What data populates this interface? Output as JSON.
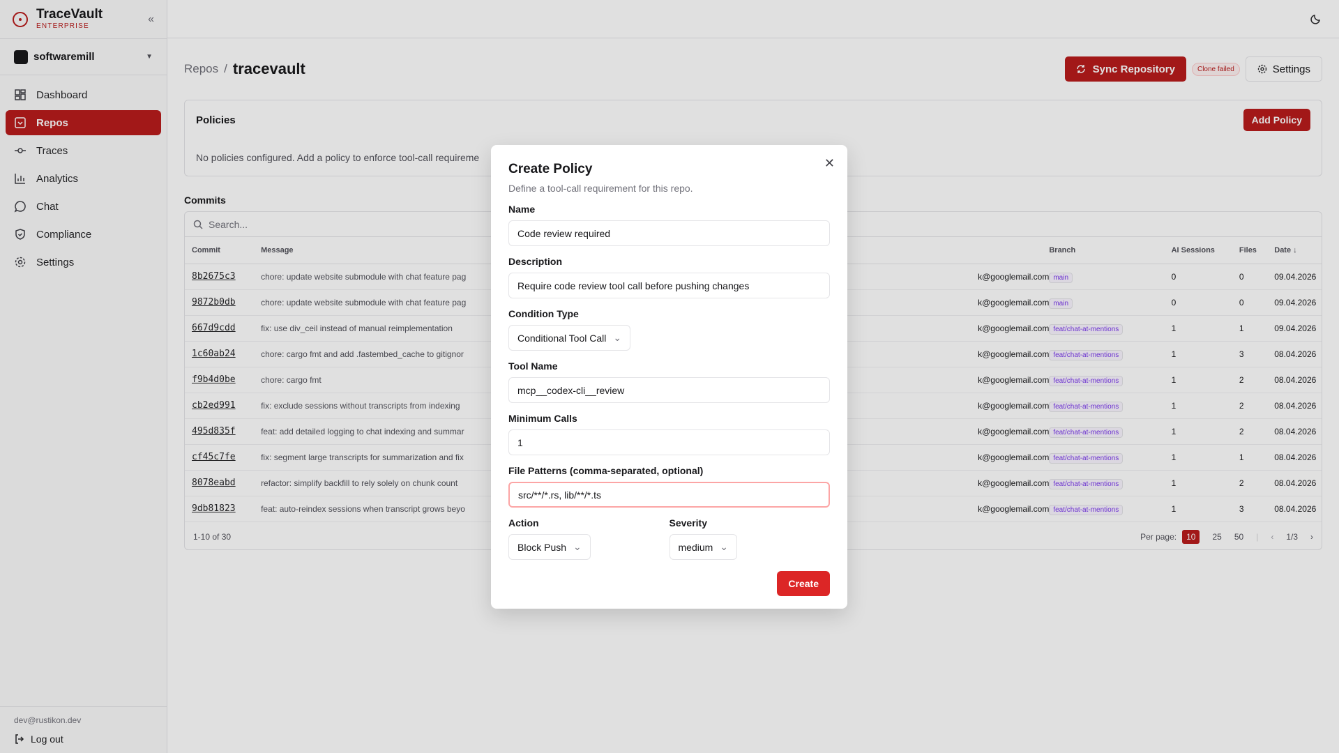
{
  "brand": {
    "name": "TraceVault",
    "tier": "ENTERPRISE"
  },
  "org": {
    "name": "softwaremill"
  },
  "nav": [
    {
      "label": "Dashboard",
      "icon": "dashboard-icon",
      "active": false
    },
    {
      "label": "Repos",
      "icon": "repo-icon",
      "active": true
    },
    {
      "label": "Traces",
      "icon": "traces-icon",
      "active": false
    },
    {
      "label": "Analytics",
      "icon": "analytics-icon",
      "active": false
    },
    {
      "label": "Chat",
      "icon": "chat-icon",
      "active": false
    },
    {
      "label": "Compliance",
      "icon": "shield-icon",
      "active": false
    },
    {
      "label": "Settings",
      "icon": "gear-icon",
      "active": false
    }
  ],
  "user": {
    "email": "dev@rustikon.dev",
    "logout_label": "Log out"
  },
  "breadcrumb": {
    "parent": "Repos",
    "separator": "/",
    "current": "tracevault"
  },
  "header": {
    "sync_label": "Sync Repository",
    "status_badge": "Clone failed",
    "settings_label": "Settings"
  },
  "policies": {
    "title": "Policies",
    "add_label": "Add Policy",
    "empty_text": "No policies configured. Add a policy to enforce tool-call requireme"
  },
  "commits": {
    "title": "Commits",
    "search_placeholder": "Search...",
    "columns": {
      "commit": "Commit",
      "message": "Message",
      "branch": "Branch",
      "sessions": "AI Sessions",
      "files": "Files",
      "date": "Date ↓"
    },
    "rows": [
      {
        "hash": "8b2675c3",
        "message": "chore: update website submodule with chat feature pag",
        "author": "k@googlemail.com",
        "branch": "main",
        "sessions": "0",
        "files": "0",
        "date": "09.04.2026"
      },
      {
        "hash": "9872b0db",
        "message": "chore: update website submodule with chat feature pag",
        "author": "k@googlemail.com",
        "branch": "main",
        "sessions": "0",
        "files": "0",
        "date": "09.04.2026"
      },
      {
        "hash": "667d9cdd",
        "message": "fix: use div_ceil instead of manual reimplementation",
        "author": "k@googlemail.com",
        "branch": "feat/chat-at-mentions",
        "sessions": "1",
        "files": "1",
        "date": "09.04.2026"
      },
      {
        "hash": "1c60ab24",
        "message": "chore: cargo fmt and add .fastembed_cache to gitignor",
        "author": "k@googlemail.com",
        "branch": "feat/chat-at-mentions",
        "sessions": "1",
        "files": "3",
        "date": "08.04.2026"
      },
      {
        "hash": "f9b4d0be",
        "message": "chore: cargo fmt",
        "author": "k@googlemail.com",
        "branch": "feat/chat-at-mentions",
        "sessions": "1",
        "files": "2",
        "date": "08.04.2026"
      },
      {
        "hash": "cb2ed991",
        "message": "fix: exclude sessions without transcripts from indexing",
        "author": "k@googlemail.com",
        "branch": "feat/chat-at-mentions",
        "sessions": "1",
        "files": "2",
        "date": "08.04.2026"
      },
      {
        "hash": "495d835f",
        "message": "feat: add detailed logging to chat indexing and summar",
        "author": "k@googlemail.com",
        "branch": "feat/chat-at-mentions",
        "sessions": "1",
        "files": "2",
        "date": "08.04.2026"
      },
      {
        "hash": "cf45c7fe",
        "message": "fix: segment large transcripts for summarization and fix",
        "author": "k@googlemail.com",
        "branch": "feat/chat-at-mentions",
        "sessions": "1",
        "files": "1",
        "date": "08.04.2026"
      },
      {
        "hash": "8078eabd",
        "message": "refactor: simplify backfill to rely solely on chunk count",
        "author": "k@googlemail.com",
        "branch": "feat/chat-at-mentions",
        "sessions": "1",
        "files": "2",
        "date": "08.04.2026"
      },
      {
        "hash": "9db81823",
        "message": "feat: auto-reindex sessions when transcript grows beyo",
        "author": "k@googlemail.com",
        "branch": "feat/chat-at-mentions",
        "sessions": "1",
        "files": "3",
        "date": "08.04.2026"
      }
    ],
    "range_text": "1-10 of 30",
    "per_page_label": "Per page:",
    "per_page_options": [
      "10",
      "25",
      "50"
    ],
    "page_text": "1/3"
  },
  "modal": {
    "title": "Create Policy",
    "subtitle": "Define a tool-call requirement for this repo.",
    "name_label": "Name",
    "name_value": "Code review required",
    "description_label": "Description",
    "description_value": "Require code review tool call before pushing changes",
    "condition_label": "Condition Type",
    "condition_value": "Conditional Tool Call",
    "tool_label": "Tool Name",
    "tool_value": "mcp__codex-cli__review",
    "min_calls_label": "Minimum Calls",
    "min_calls_value": "1",
    "patterns_label": "File Patterns (comma-separated, optional)",
    "patterns_value": "src/**/*.rs, lib/**/*.ts",
    "action_label": "Action",
    "action_value": "Block Push",
    "severity_label": "Severity",
    "severity_value": "medium",
    "create_label": "Create"
  },
  "colors": {
    "accent": "#b91c1c",
    "create": "#dc2626"
  }
}
